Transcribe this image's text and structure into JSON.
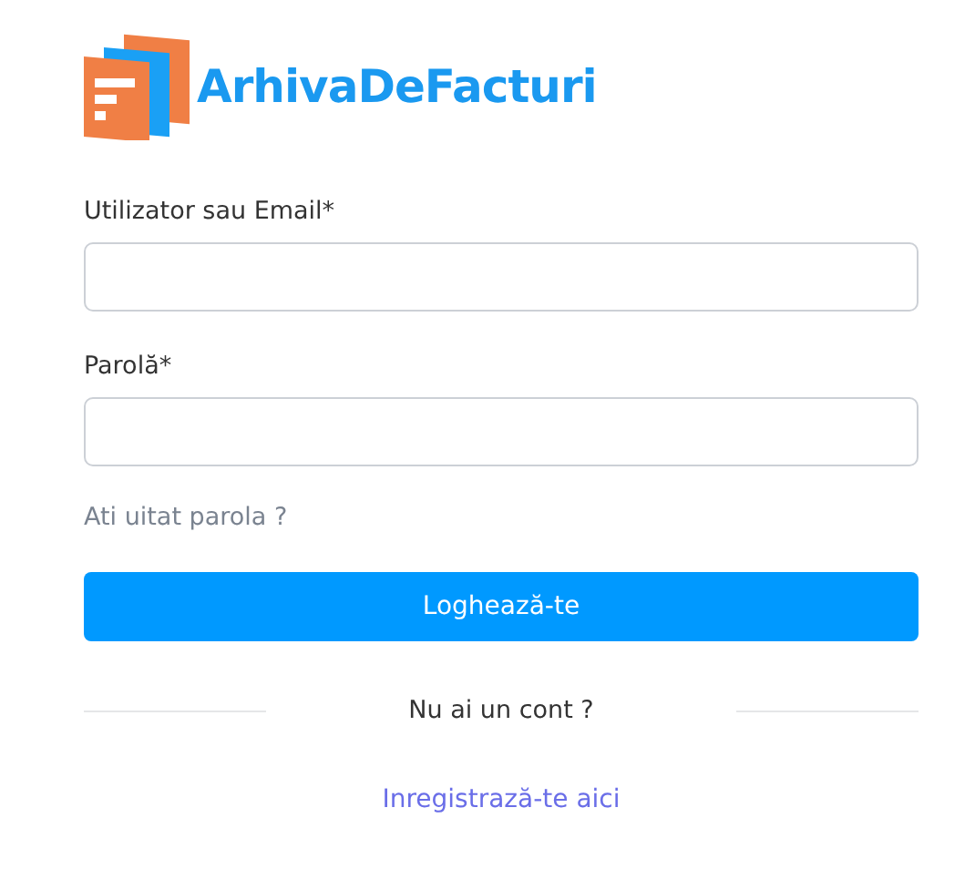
{
  "logo": {
    "text": "ArhivaDeFacturi"
  },
  "fields": [
    {
      "label": "Utilizator sau Email*"
    },
    {
      "label": "Parolă*"
    }
  ],
  "forgot_link": "Ati uitat parola ?",
  "login_button": "Loghează-te",
  "divider_text": "Nu ai un cont ?",
  "register_link": "Inregistrază-te aici"
}
